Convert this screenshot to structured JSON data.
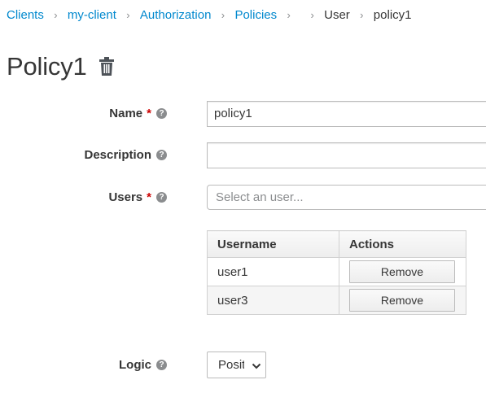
{
  "breadcrumb": {
    "items": [
      {
        "label": "Clients"
      },
      {
        "label": "my-client"
      },
      {
        "label": "Authorization"
      },
      {
        "label": "Policies"
      },
      {
        "label": ""
      },
      {
        "label": "User"
      },
      {
        "label": "policy1"
      }
    ]
  },
  "page": {
    "title": "Policy1"
  },
  "form": {
    "name": {
      "label": "Name",
      "required_mark": "*",
      "value": "policy1"
    },
    "description": {
      "label": "Description",
      "value": ""
    },
    "users": {
      "label": "Users",
      "required_mark": "*",
      "placeholder": "Select an user..."
    },
    "logic": {
      "label": "Logic",
      "selected": "Positive"
    }
  },
  "users_table": {
    "columns": [
      "Username",
      "Actions"
    ],
    "rows": [
      {
        "username": "user1",
        "action": "Remove"
      },
      {
        "username": "user3",
        "action": "Remove"
      }
    ]
  },
  "icons": {
    "delete": "trash-icon",
    "help": "help-icon",
    "dropdown": "chevron-down-icon"
  },
  "colors": {
    "link": "#0088ce",
    "required": "#cc0000"
  }
}
